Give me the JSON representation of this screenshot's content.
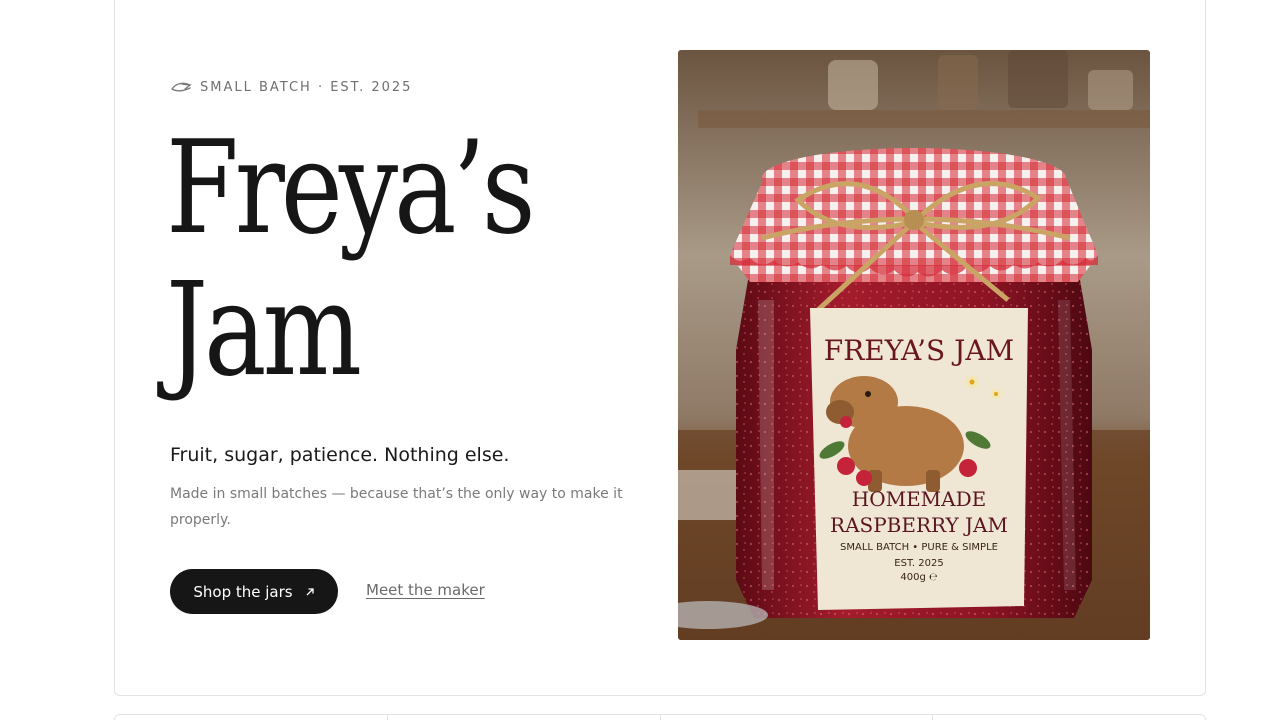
{
  "hero": {
    "eyebrow": "SMALL BATCH · EST. 2025",
    "title_line1": "Freya’s",
    "title_line2": "Jam",
    "tagline": "Fruit, sugar, patience. Nothing else.",
    "description": "Made in small batches — because that’s the only way to make it properly.",
    "primary_cta": "Shop the jars",
    "secondary_cta": "Meet the maker"
  },
  "product_image": {
    "label_title": "FREYA’S JAM",
    "label_line1": "HOMEMADE",
    "label_line2": "RASPBERRY JAM",
    "label_line3": "SMALL BATCH • PURE & SIMPLE",
    "label_line4": "EST. 2025",
    "label_line5": "400g ℮"
  },
  "icons": {
    "eyebrow": "leaf-arrow-icon",
    "cta": "arrow-up-right-icon"
  },
  "colors": {
    "primary_button": "#161616",
    "jam_red": "#9b1b2a",
    "gingham_red": "#d42a36"
  }
}
